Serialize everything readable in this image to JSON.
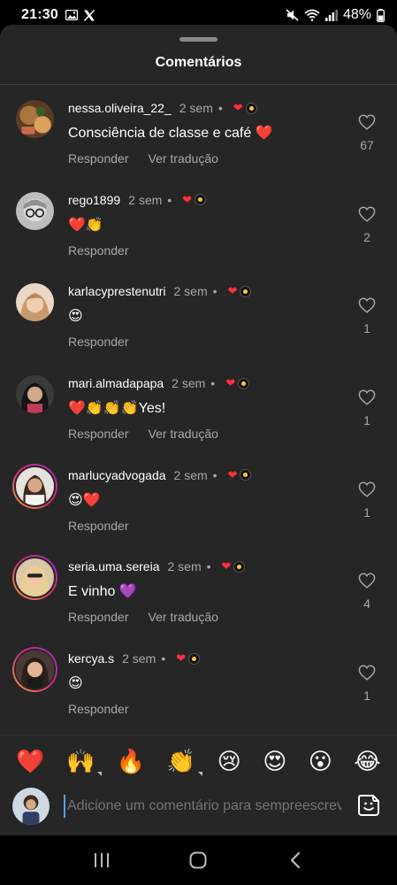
{
  "status_bar": {
    "time": "21:30",
    "battery": "48%",
    "left_icons": [
      "image-icon",
      "x-icon"
    ],
    "right_icons": [
      "mute-icon",
      "wifi-icon",
      "signal-icon",
      "battery-icon"
    ]
  },
  "sheet": {
    "title": "Comentários"
  },
  "comments": [
    {
      "username": "nessa.oliveira_22_",
      "time": "2 sem",
      "dot": "•",
      "text": "Consciência de classe e café ❤️",
      "reply_label": "Responder",
      "translate_label": "Ver tradução",
      "likes": "67",
      "avatar_colors": [
        "#6b4a2a",
        "#b9874c"
      ]
    },
    {
      "username": "rego1899",
      "time": "2 sem",
      "dot": "•",
      "text": "❤️👏",
      "reply_label": "Responder",
      "translate_label": "",
      "likes": "2",
      "avatar_colors": [
        "#9b9b9b",
        "#d0d0d0"
      ]
    },
    {
      "username": "karlacyprestenutri",
      "time": "2 sem",
      "dot": "•",
      "text": "😍",
      "reply_label": "Responder",
      "translate_label": "",
      "likes": "1",
      "avatar_colors": [
        "#c9a07e",
        "#e8cdb4"
      ]
    },
    {
      "username": "mari.almadapapa",
      "time": "2 sem",
      "dot": "•",
      "text": "❤️👏👏👏Yes!",
      "reply_label": "Responder",
      "translate_label": "Ver tradução",
      "likes": "1",
      "avatar_colors": [
        "#2a2a2a",
        "#5a4038"
      ]
    },
    {
      "username": "marlucyadvogada",
      "time": "2 sem",
      "dot": "•",
      "text": "😍❤️",
      "reply_label": "Responder",
      "translate_label": "",
      "likes": "1",
      "avatar_colors": [
        "#3d2f2a",
        "#a9876b"
      ]
    },
    {
      "username": "seria.uma.sereia",
      "time": "2 sem",
      "dot": "•",
      "text": "E vinho 💜",
      "reply_label": "Responder",
      "translate_label": "Ver tradução",
      "likes": "4",
      "avatar_colors": [
        "#c9a66b",
        "#efd7a6"
      ]
    },
    {
      "username": "kercya.s",
      "time": "2 sem",
      "dot": "•",
      "text": "😍",
      "reply_label": "Responder",
      "translate_label": "",
      "likes": "1",
      "avatar_colors": [
        "#4a3a34",
        "#c79b7c"
      ]
    }
  ],
  "reactions": [
    "❤️",
    "🙌",
    "🔥",
    "👏",
    "😢",
    "😍",
    "😮",
    "😂"
  ],
  "input": {
    "placeholder": "Adicione um comentário para sempreescrevendo"
  },
  "colors": {
    "sheet_bg": "#262626",
    "like_red": "#ff3040",
    "secondary_text": "#a8a8a8",
    "story_ring": "#d62976"
  }
}
